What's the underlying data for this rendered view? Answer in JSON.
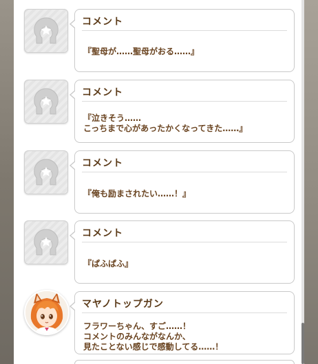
{
  "comments": [
    {
      "name": "コメント",
      "message": "『聖母が……聖母がおる……』",
      "avatar": "default-avatar-icon"
    },
    {
      "name": "コメント",
      "message": "『泣きそう……\nこっちまで心があったかくなってきた……』",
      "avatar": "default-avatar-icon"
    },
    {
      "name": "コメント",
      "message": "『俺も励まされたい……！』",
      "avatar": "default-avatar-icon"
    },
    {
      "name": "コメント",
      "message": "『ぱふぱふ』",
      "avatar": "default-avatar-icon"
    },
    {
      "name": "マヤノトップガン",
      "message": "フラワーちゃん、すご……！\nコメントのみんながなんか、\n見たことない感じで感動してる……！",
      "avatar": "character-portrait"
    }
  ],
  "colors": {
    "name_text": "#5b3a18",
    "message_text": "#6b4522",
    "bubble_border": "#c9c9c9"
  }
}
